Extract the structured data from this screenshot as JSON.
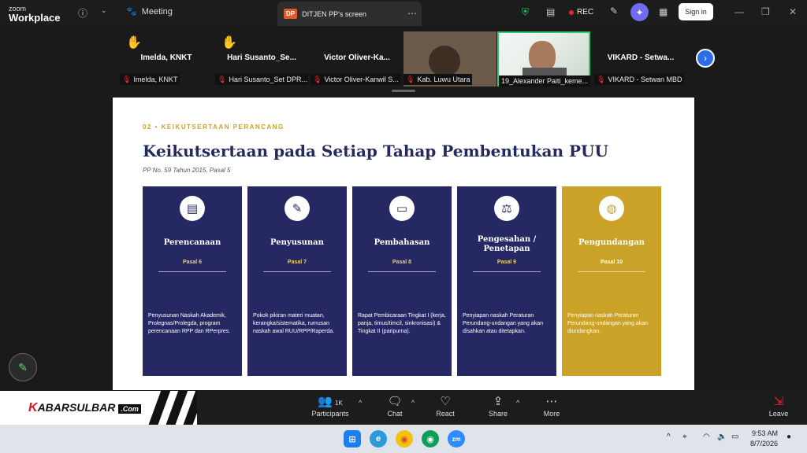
{
  "titlebar": {
    "logo_line1": "zoom",
    "logo_line2": "Workplace",
    "info_icon": "info-icon",
    "meeting_label": "Meeting",
    "share_badge": "DP",
    "share_title": "DITJEN PP's screen",
    "rec_label": "REC",
    "signin_label": "Sign in"
  },
  "participants": [
    {
      "name": "Imelda, KNKT",
      "label": "Imelda, KNKT",
      "hand": true
    },
    {
      "name": "Hari  Susanto_Se...",
      "label": "Hari Susanto_Set DPR...",
      "hand": true
    },
    {
      "name": "Victor  Oliver-Ka...",
      "label": "Victor Oliver-Kanwil S...",
      "hand": false
    },
    {
      "name": "",
      "label": "Kab. Luwu Utara",
      "hand": false,
      "video": true
    },
    {
      "name": "",
      "label": "19_Alexander Paiti_keme...",
      "hand": false,
      "video": true
    },
    {
      "name": "VIKARD - Setwa...",
      "label": "VIKARD - Setwan MBD",
      "hand": false
    }
  ],
  "slide": {
    "section": "02  •  KEIKUTSERTAAN PERANCANG",
    "title": "Keikutsertaan pada Setiap Tahap Pembentukan PUU",
    "subtitle": "PP No. 59 Tahun 2015, Pasal 5",
    "cards": [
      {
        "icon": "document-icon",
        "title": "Perencanaan",
        "pasal": "Pasal 6",
        "desc": "Penyusunan Naskah Akademik, Prolegnas/Prolegda, program perencanaan RPP dan RPerpres."
      },
      {
        "icon": "pencil-icon",
        "title": "Penyusunan",
        "pasal": "Pasal 7",
        "desc": "Pokok pikiran materi muatan, kerangka/sistematika, rumusan naskah awal RUU/RPP/Raperda."
      },
      {
        "icon": "chat-icon",
        "title": "Pembahasan",
        "pasal": "Pasal 8",
        "desc": "Rapat Pembicaraan Tingkat I (kerja, panja, timus/timcil, sinkronisasi) & Tingkat II (paripurna)."
      },
      {
        "icon": "gavel-icon",
        "title": "Pengesahan / Penetapan",
        "pasal": "Pasal 9",
        "desc": "Penyiapan naskah Peraturan Perundang-undangan yang akan disahkan atau ditetapkan."
      },
      {
        "icon": "globe-icon",
        "title": "Pengundangan",
        "pasal": "Pasal 10",
        "desc": "Penyiapan naskah Peraturan Perundang-undangan yang akan diundangkan."
      }
    ]
  },
  "toolbar": {
    "brand_k": "K",
    "brand_text": "ABARSULBAR",
    "brand_com": ".Com",
    "participants_label": "Participants",
    "participants_count": "1K",
    "chat_label": "Chat",
    "react_label": "React",
    "share_label": "Share",
    "more_label": "More",
    "leave_label": "Leave"
  },
  "taskbar": {
    "time": "9:53 AM",
    "date": "8/7/2026"
  }
}
